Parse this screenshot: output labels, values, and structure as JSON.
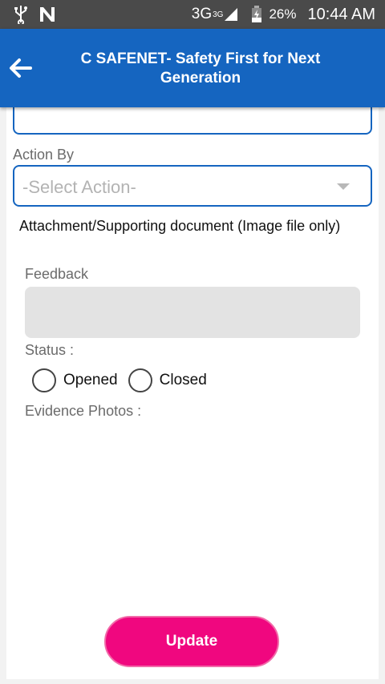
{
  "status_bar": {
    "icons_left": [
      "usb-icon",
      "n-icon"
    ],
    "network": "3G",
    "network_sup": "3G",
    "battery": "26%",
    "time": "10:44 AM"
  },
  "app_bar": {
    "title": "C SAFENET- Safety First for Next Generation",
    "back_icon": "arrow-back-icon"
  },
  "form": {
    "action_by_label": "Action By",
    "action_select_value": "-Select Action-",
    "attachment_label": "Attachment/Supporting document (Image file only)",
    "feedback_label": "Feedback",
    "feedback_value": "",
    "status_label": "Status :",
    "status_options": [
      "Opened",
      "Closed"
    ],
    "evidence_label": "Evidence Photos :",
    "update_label": "Update"
  },
  "colors": {
    "status_bar": "#4a4a4a",
    "app_bar": "#1565c0",
    "field_border": "#1565c0",
    "update_button": "#f0077f"
  }
}
